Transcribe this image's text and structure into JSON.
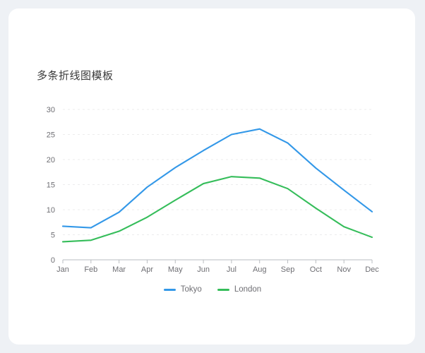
{
  "card": {
    "background": "#ffffff",
    "page_background": "#eef1f5"
  },
  "chart_data": {
    "type": "line",
    "title": "多条折线图模板",
    "xlabel": "",
    "ylabel": "",
    "categories": [
      "Jan",
      "Feb",
      "Mar",
      "Apr",
      "May",
      "Jun",
      "Jul",
      "Aug",
      "Sep",
      "Oct",
      "Nov",
      "Dec"
    ],
    "series": [
      {
        "name": "Tokyo",
        "color": "#3398e8",
        "values": [
          6.7,
          6.4,
          9.5,
          14.5,
          18.4,
          21.8,
          25.0,
          26.1,
          23.3,
          18.3,
          13.9,
          9.6
        ]
      },
      {
        "name": "London",
        "color": "#35bd5a",
        "values": [
          3.6,
          3.9,
          5.7,
          8.5,
          11.9,
          15.2,
          16.6,
          16.3,
          14.2,
          10.3,
          6.6,
          4.5
        ]
      }
    ],
    "y_ticks": [
      0,
      5,
      10,
      15,
      20,
      25,
      30
    ],
    "ylim": [
      0,
      30
    ],
    "grid": true,
    "legend_position": "bottom",
    "tick_label_color": "#6e6e73",
    "grid_color": "#ececed",
    "axis_color": "#b9bcc0"
  }
}
